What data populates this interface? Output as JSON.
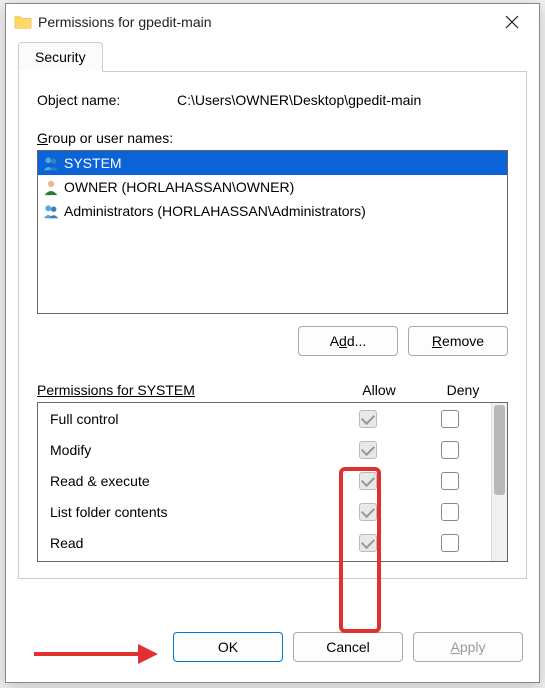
{
  "window": {
    "title": "Permissions for gpedit-main"
  },
  "tab": {
    "security": "Security"
  },
  "object_name": {
    "label": "Object name:",
    "value": "C:\\Users\\OWNER\\Desktop\\gpedit-main"
  },
  "group_label_prefix": "G",
  "group_label_rest": "roup or user names:",
  "users": [
    {
      "name": "SYSTEM",
      "icon": "group",
      "selected": true
    },
    {
      "name": "OWNER (HORLAHASSAN\\OWNER)",
      "icon": "user",
      "selected": false
    },
    {
      "name": "Administrators (HORLAHASSAN\\Administrators)",
      "icon": "group",
      "selected": false
    }
  ],
  "buttons": {
    "add_prefix": "A",
    "add_u": "d",
    "add_suffix": "d...",
    "remove_u": "R",
    "remove_rest": "emove",
    "ok": "OK",
    "cancel": "Cancel",
    "apply_u": "A",
    "apply_rest": "pply"
  },
  "perm_header": {
    "title_u": "P",
    "title_rest": "ermissions for SYSTEM",
    "allow": "Allow",
    "deny": "Deny"
  },
  "permissions": [
    {
      "name": "Full control",
      "allow": true,
      "deny": false
    },
    {
      "name": "Modify",
      "allow": true,
      "deny": false
    },
    {
      "name": "Read & execute",
      "allow": true,
      "deny": false
    },
    {
      "name": "List folder contents",
      "allow": true,
      "deny": false
    },
    {
      "name": "Read",
      "allow": true,
      "deny": false
    }
  ],
  "colors": {
    "accent_blue": "#0078d4",
    "selection_blue": "#0a64d8",
    "highlight_red": "#e03030"
  }
}
